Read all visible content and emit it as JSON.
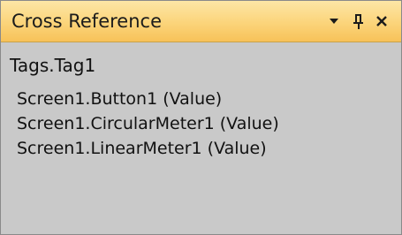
{
  "panel": {
    "title": "Cross Reference",
    "buttons": {
      "dropdown_icon": "chevron-down-icon",
      "pin_icon": "pin-icon",
      "close_icon": "close-icon"
    },
    "colors": {
      "header_top": "#fde6a6",
      "header_bottom": "#f7c259",
      "content_bg": "#c9c9c9"
    }
  },
  "content": {
    "root": "Tags.Tag1",
    "references": [
      "Screen1.Button1 (Value)",
      "Screen1.CircularMeter1 (Value)",
      "Screen1.LinearMeter1 (Value)"
    ]
  }
}
